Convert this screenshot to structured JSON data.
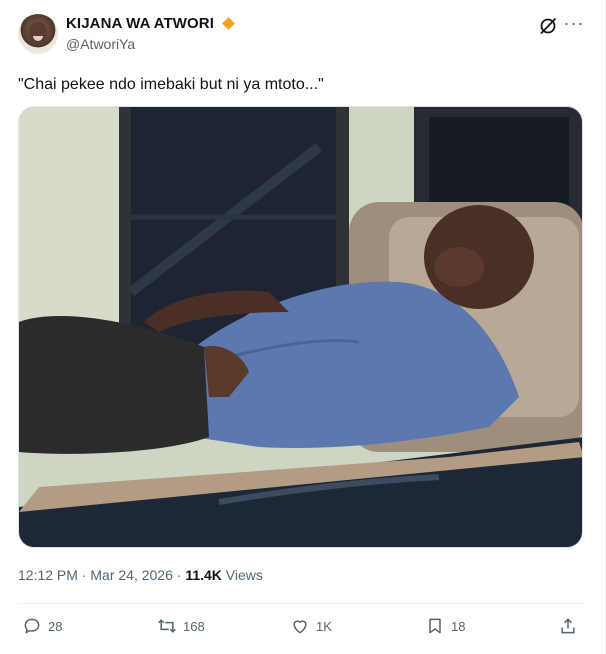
{
  "author": {
    "display_name": "KIJANA WA ATWORI",
    "handle": "@AtworiYa",
    "badge_color": "#f4a11d"
  },
  "tweet": {
    "text": "\"Chai pekee ndo imebaki but ni ya mtoto...\"",
    "media_description_icon": "photo"
  },
  "meta": {
    "timestamp": "12:12 PM · Mar 24, 2026 · ",
    "views_count": "11.4K",
    "views_label": " Views"
  },
  "actions": {
    "replies": "28",
    "reposts": "168",
    "likes": "1K",
    "bookmarks": "18"
  },
  "icons": [
    "grok-icon",
    "more-icon",
    "reply-icon",
    "repost-icon",
    "like-icon",
    "bookmark-icon",
    "share-icon"
  ],
  "colors": {
    "text_primary": "#0f1419",
    "text_secondary": "#536471",
    "divider": "#eff3f4"
  }
}
